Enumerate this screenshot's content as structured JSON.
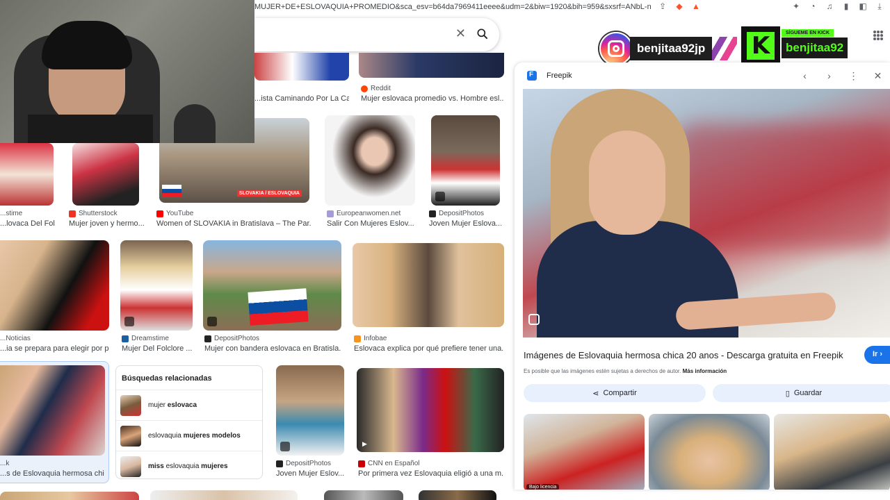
{
  "browser": {
    "url": "MUJER+DE+ESLOVAQUIA+PROMEDIO&sca_esv=b64da7969411eeee&udm=2&biw=1920&bih=959&sxsrf=ANbL-n6P7oY8X..."
  },
  "overlay": {
    "instagram_handle": "benjitaa92jp",
    "kick_follow": "SÍGUEME EN KICK",
    "kick_handle": "benjitaa92"
  },
  "colors": {
    "accent": "#1a73e8",
    "kick_green": "#53fc18"
  },
  "results": {
    "row0": [
      {
        "title": "...ista Caminando Por La Ca...",
        "source": ""
      },
      {
        "title": "Mujer eslovaca promedio vs. Hombre esl...",
        "source": "Reddit"
      }
    ],
    "row1": [
      {
        "source": "...stime",
        "title": "...lovaca Del Fol..."
      },
      {
        "source": "Shutterstock",
        "title": "Mujer joven y hermo..."
      },
      {
        "source": "YouTube",
        "title": "Women of SLOVAKIA in Bratislava – The Par...",
        "overlay_text": "SLOVAKIA / ESLOVAQUIA"
      },
      {
        "source": "Europeanwomen.net",
        "title": "Salir Con Mujeres Eslov..."
      },
      {
        "source": "DepositPhotos",
        "title": "Joven Mujer Eslova..."
      }
    ],
    "row2": [
      {
        "source": "...Noticias",
        "title": "...ia se prepara para elegir por p..."
      },
      {
        "source": "Dreamstime",
        "title": "Mujer Del Folclore ..."
      },
      {
        "source": "DepositPhotos",
        "title": "Mujer con bandera eslovaca en Bratisla..."
      },
      {
        "source": "Infobae",
        "title": "Eslovaca explica por qué prefiere tener una..."
      }
    ],
    "row3": [
      {
        "source": "...k",
        "title": "...s de Eslovaquia hermosa chi..."
      },
      {
        "source": "DepositPhotos",
        "title": "Joven Mujer Eslov..."
      },
      {
        "source": "CNN en Español",
        "title": "Por primera vez Eslovaquia eligió a una m..."
      }
    ]
  },
  "related": {
    "heading": "Búsquedas relacionadas",
    "items": [
      {
        "plain": "mujer ",
        "bold": "eslovaca",
        "tail": ""
      },
      {
        "plain": "eslovaquia ",
        "bold": "mujeres modelos",
        "tail": ""
      },
      {
        "plain": "",
        "bold": "miss",
        "tail": " eslovaquia ",
        "bold2": "mujeres"
      }
    ]
  },
  "panel": {
    "source": "Freepik",
    "title": "Imágenes de Eslovaquia hermosa chica 20 anos - Descarga gratuita en Freepik",
    "go_label": "Ir",
    "note": "Es posible que las imágenes estén sujetas a derechos de autor.",
    "note_link": "Más información",
    "share_label": "Compartir",
    "save_label": "Guardar",
    "thumb_label": "Bajo licencia"
  },
  "icons": {
    "clear": "close-icon",
    "search": "search-icon",
    "prev": "chevron-left-icon",
    "next": "chevron-right-icon",
    "more": "more-vert-icon",
    "close": "close-icon",
    "share": "share-icon",
    "bookmark": "bookmark-icon",
    "lens": "lens-icon",
    "apps": "apps-icon"
  }
}
